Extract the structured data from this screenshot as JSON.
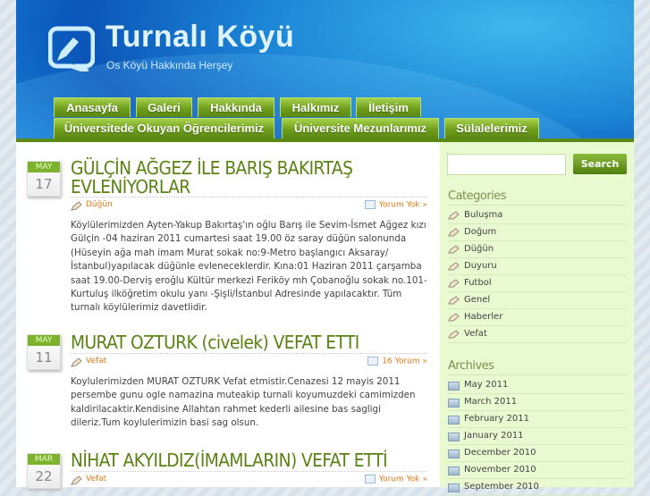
{
  "site": {
    "title": "Turnalı Köyü",
    "description": "Os Köyü Hakkında Herşey"
  },
  "nav": {
    "row1": [
      "Anasayfa",
      "Galeri",
      "Hakkında",
      "Halkımız",
      "İletişim"
    ],
    "row2": [
      "Üniversitede Okuyan Öğrencilerimiz",
      "Üniversite Mezunlarımız",
      "Sülalelerimiz"
    ]
  },
  "posts": [
    {
      "month": "MAY",
      "day": "17",
      "title": "GÜLÇİN AĞGEZ İLE BARIŞ BAKIRTAŞ EVLENİYORLAR",
      "category": "Düğün",
      "comments": "Yorum Yok »",
      "body": "Köylülerimizden Ayten-Yakup Bakırtaş'ın oğlu Barış ile Sevim-İsmet Ağgez kızı Gülçin -04 haziran 2011 cumartesi saat 19.00  öz saray düğün salonunda (Hüseyin ağa mah imam Murat sokak no:9-Metro başlangıcı Aksaray/İstanbul)yapılacak düğünle evleneceklerdir. Kına:01 Haziran 2011 çarşamba saat 19.00-Derviş eroğlu Kültür merkezi Feriköy mh Çobanoğlu sokak no.101-Kurtuluş ilköğretim okulu yanı -Şişli/İstanbul Adresinde yapılacaktır. Tüm turnalı köylülerimiz davetlidir."
    },
    {
      "month": "MAY",
      "day": "11",
      "title": "MURAT OZTURK (civelek) VEFAT ETTI",
      "category": "Vefat",
      "comments": "16 Yorum »",
      "body": "Koylulerimizden MURAT OZTURK Vefat etmistir.Cenazesi 12 mayis 2011 persembe gunu ogle namazina muteakip turnali koyumuzdeki camimizden kaldirilacaktir.Kendisine Allahtan rahmet kederli ailesine bas sagligi dileriz.Tum koylulerimizin basi sag olsun."
    },
    {
      "month": "MAR",
      "day": "22",
      "title": "NİHAT AKYILDIZ(İMAMLARIN) VEFAT ETTİ",
      "category": "Vefat",
      "comments": "Yorum Yok »"
    }
  ],
  "sidebar": {
    "search_button": "Search",
    "search_placeholder": "",
    "categories_title": "Categories",
    "categories": [
      "Buluşma",
      "Doğum",
      "Düğün",
      "Duyuru",
      "Futbol",
      "Genel",
      "Haberler",
      "Vefat"
    ],
    "archives_title": "Archives",
    "archives": [
      "May 2011",
      "March 2011",
      "February 2011",
      "January 2011",
      "December 2010",
      "November 2010",
      "September 2010"
    ]
  }
}
